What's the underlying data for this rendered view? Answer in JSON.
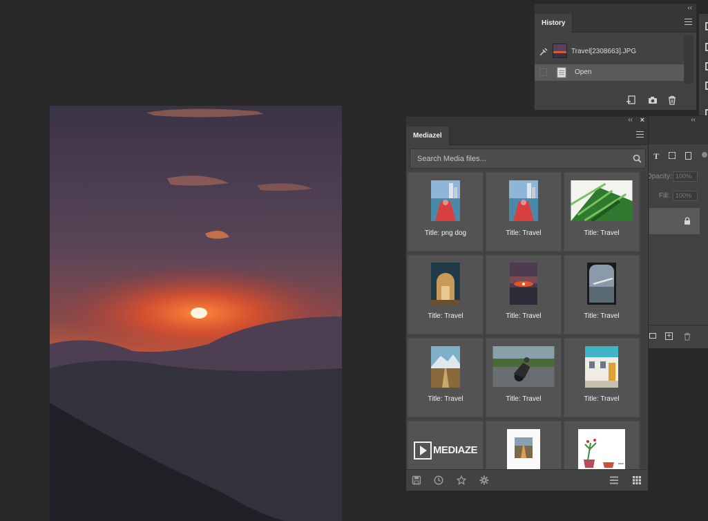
{
  "history": {
    "tab_label": "History",
    "snapshot_name": "Travel[2308663].JPG",
    "step_open": "Open",
    "icons": [
      "new-document-icon",
      "camera-icon",
      "trash-icon"
    ]
  },
  "layers": {
    "opacity_label": "Opacity:",
    "opacity_value": "100%",
    "fill_label": "Fill:",
    "fill_value": "100%"
  },
  "mediazel": {
    "tab_label": "Mediazel",
    "search_placeholder": "Search Media files...",
    "items": [
      {
        "caption": "Title: png dog",
        "thumb": "kayak"
      },
      {
        "caption": "Title: Travel",
        "thumb": "kayak"
      },
      {
        "caption": "Title: Travel",
        "thumb": "palm"
      },
      {
        "caption": "Title: Travel",
        "thumb": "arch"
      },
      {
        "caption": "Title: Travel",
        "thumb": "sunset"
      },
      {
        "caption": "Title: Travel",
        "thumb": "plane"
      },
      {
        "caption": "Title: Travel",
        "thumb": "road"
      },
      {
        "caption": "Title: Travel",
        "thumb": "moto"
      },
      {
        "caption": "Title: Travel",
        "thumb": "house"
      },
      {
        "caption": "",
        "thumb": "logo",
        "logo_text": "MEDIAZEL"
      },
      {
        "caption": "",
        "thumb": "poster"
      },
      {
        "caption": "",
        "thumb": "plants"
      }
    ],
    "footer_icons": [
      "save-icon",
      "clock-icon",
      "star-icon",
      "gear-icon",
      "list-view-icon",
      "grid-view-icon"
    ]
  },
  "colors": {
    "app_bg": "#282828",
    "panel_bg": "#424242",
    "cell_bg": "#535353",
    "selected_row": "#5a5a5a"
  }
}
